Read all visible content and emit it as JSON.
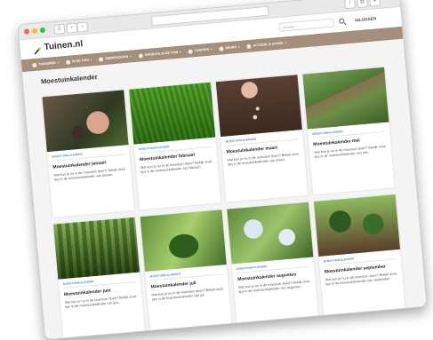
{
  "browser": {
    "url": "",
    "colors": {
      "close": "#ff5f57",
      "minimize": "#febc2e",
      "maximize": "#28c840"
    }
  },
  "header": {
    "logo_text": "Tuinen.nl",
    "search_placeholder": "Zoeken",
    "login_label": "INLOGGEN"
  },
  "nav": {
    "items": [
      {
        "label": "TUINIEREN",
        "icon": "plant-icon"
      },
      {
        "label": "IN DE TUIN",
        "icon": "shed-icon"
      },
      {
        "label": "DIERENZAKEN",
        "icon": "animal-icon"
      },
      {
        "label": "GROENTE IN DE TUIN",
        "icon": "pot-icon"
      },
      {
        "label": "TUINTIPS",
        "icon": "shovel-icon"
      },
      {
        "label": "BEURS",
        "icon": "flower-icon"
      },
      {
        "label": "ACTUEEL & ZAKEN",
        "icon": "leaf-icon"
      }
    ]
  },
  "main": {
    "page_title": "Moestuinkalender",
    "cards": [
      {
        "tag": "MOESTUINKALENDER",
        "title": "Moestuinkalender januari",
        "text": "Wat kun je nu in de moestuin doen? Bekijk onze tips in de moestuinkalender van januari."
      },
      {
        "tag": "MOESTUINKALENDER",
        "title": "Moestuinkalender februari",
        "text": "Wat kun je nu in de moestuin doen? Bekijk onze tips in de moestuinkalender van februari."
      },
      {
        "tag": "MOESTUINKALENDER",
        "title": "Moestuinkalender maart",
        "text": "Wat kun je nu in de moestuin doen? Bekijk onze tips in de moestuinkalender van maart."
      },
      {
        "tag": "MOESTUINKALENDER",
        "title": "Moestuinkalender mei",
        "text": "Wat kun je nu in de moestuin doen? Bekijk onze tips in de moestuinkalender van mei."
      },
      {
        "tag": "MOESTUINKALENDER",
        "title": "Moestuinkalender juni",
        "text": "Wat kun je nu in de moestuin doen? Bekijk onze tips in de moestuinkalender van juni."
      },
      {
        "tag": "MOESTUINKALENDER",
        "title": "Moestuinkalender juli",
        "text": "Wat kun je nu in de moestuin doen? Bekijk onze tips in de moestuinkalender van juli."
      },
      {
        "tag": "MOESTUINKALENDER",
        "title": "Moestuinkalender augustus",
        "text": "Wat kun je nu in de moestuin doen? Bekijk onze tips in de moestuinkalender van augustus."
      },
      {
        "tag": "MOESTUINKALENDER",
        "title": "Moestuinkalender september",
        "text": "Wat kun je nu in de moestuin doen? Bekijk onze tips in de moestuinkalender van september."
      }
    ]
  }
}
